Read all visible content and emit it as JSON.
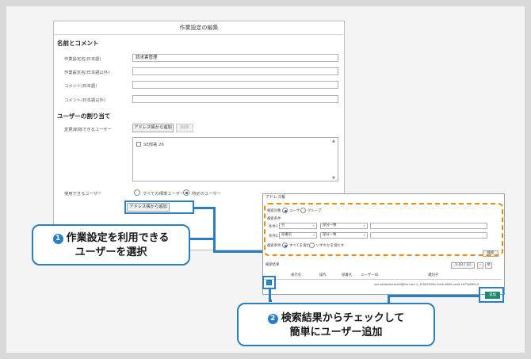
{
  "dialog": {
    "title": "作業設定の編集",
    "section_name": "名前とコメント",
    "fields": [
      {
        "label": "作業設定名(日本語)",
        "value": "請求書管理"
      },
      {
        "label": "作業設定名(日本語以外)",
        "value": ""
      },
      {
        "label": "コメント(日本語)",
        "value": ""
      },
      {
        "label": "コメント(日本語以外)",
        "value": ""
      }
    ],
    "section_users": "ユーザーの割り当て",
    "editors_label": "変更/削除できるユーザー",
    "add_from_address_book": "アドレス帳から追加",
    "delete": "削除",
    "selected_user": "SE部署 26",
    "users_label": "使用できるユーザー",
    "radio_all_users": "すべての標準ユーザー",
    "radio_specific_users": "特定のユーザー",
    "add_from_address_book_2": "アドレス帳から追加"
  },
  "search_panel": {
    "title": "アドレス帳",
    "search_target_label": "検索対象",
    "tab_user": "ユーザー",
    "tab_group": "グループ",
    "conditions_label": "検索条件",
    "cond1_label": "条件1",
    "cond1_field": "名",
    "cond1_op": "部分一致",
    "cond2_label": "条件2",
    "cond2_field": "部署名",
    "cond2_op": "部分一致",
    "match_label": "検索条件",
    "match_all": "すべてを満たす",
    "match_any": "いずれかを満たす",
    "search_button": "検索",
    "results_label": "検索結果",
    "pager_text": "1-10 / 10",
    "columns": [
      "表示名",
      "操作",
      "部署名",
      "ユーザーID",
      "識別子"
    ],
    "row_text": "xxx-sehaildocon04@lfm.com   1_10000004b-2ce8-4600-aca0-1b75a560c3",
    "add_button": "追加"
  },
  "callouts": {
    "one_num": "1",
    "one_line1": "作業設定を利用できる",
    "one_line2": "ユーザーを選択",
    "two_num": "2",
    "two_line1": "検索結果からチェックして",
    "two_line2": "簡単にユーザー追加"
  },
  "colors": {
    "accent": "#2a7fc4",
    "dashed": "#f08a00",
    "add": "#1d8a6e"
  }
}
